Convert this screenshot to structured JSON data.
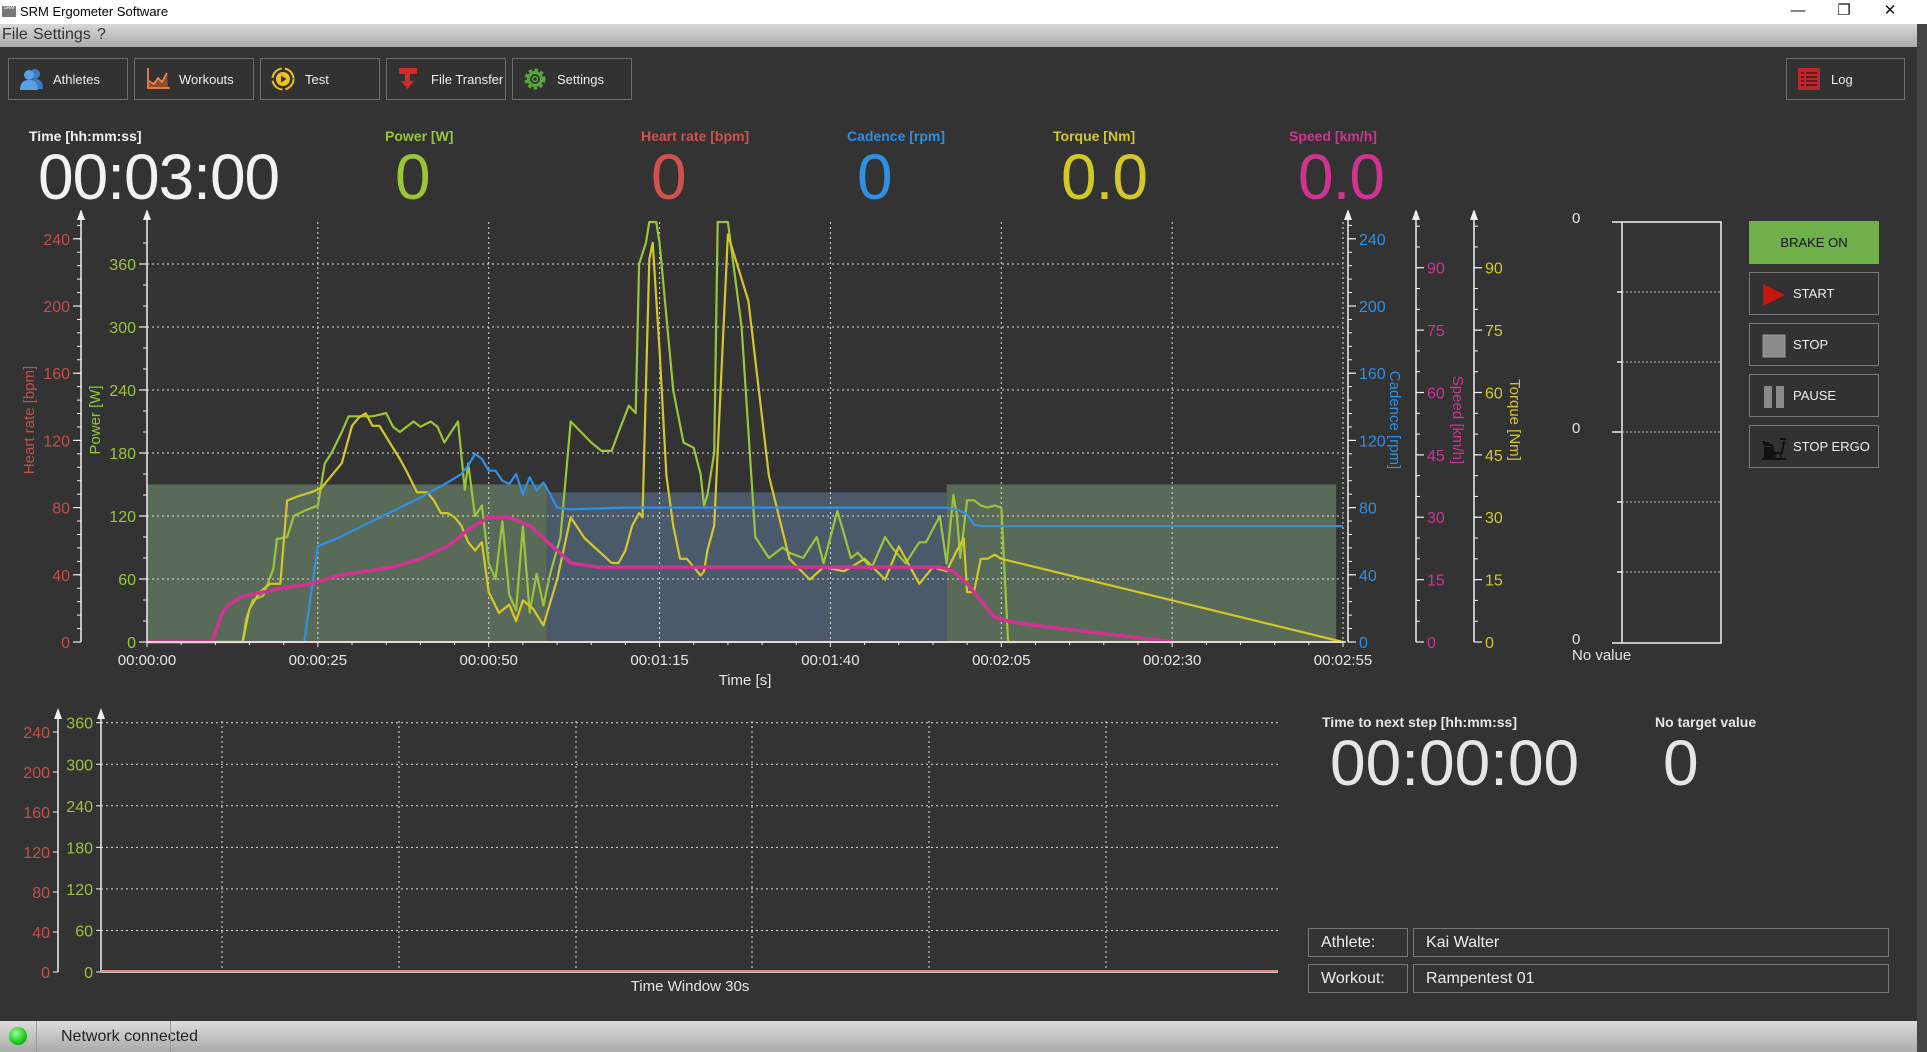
{
  "window": {
    "title": "SRM Ergometer Software",
    "minimize_glyph": "—",
    "restore_glyph": "❐",
    "close_glyph": "✕"
  },
  "menu": [
    "File",
    "Settings",
    "?"
  ],
  "toolbar": {
    "buttons": [
      {
        "label": "Athletes",
        "icon": "athletes-icon",
        "color": "#4a90d9"
      },
      {
        "label": "Workouts",
        "icon": "workouts-chart-icon",
        "color": "#e0783a"
      },
      {
        "label": "Test",
        "icon": "test-play-icon",
        "color": "#f0c020"
      },
      {
        "label": "File Transfer",
        "icon": "file-transfer-icon",
        "color": "#d22a2a"
      },
      {
        "label": "Settings",
        "icon": "settings-gear-icon",
        "color": "#5aa83c"
      }
    ],
    "log": {
      "label": "Log",
      "icon": "log-list-icon",
      "color": "#b8292f"
    }
  },
  "metrics": [
    {
      "label": "Time [hh:mm:ss]",
      "value": "00:03:00",
      "color": "#f2f2f2"
    },
    {
      "label": "Power [W]",
      "value": "0",
      "color": "#9cc43a"
    },
    {
      "label": "Heart rate [bpm]",
      "value": "0",
      "color": "#d0524f"
    },
    {
      "label": "Cadence [rpm]",
      "value": "0",
      "color": "#2f8fe3"
    },
    {
      "label": "Torque [Nm]",
      "value": "0.0",
      "color": "#d2c82a"
    },
    {
      "label": "Speed [km/h]",
      "value": "0.0",
      "color": "#cf3590"
    }
  ],
  "chart_data": [
    {
      "type": "line",
      "name": "main-chart",
      "xlabel": "Time [s]",
      "xlim": [
        0,
        175
      ],
      "x_ticks": [
        {
          "t": 0,
          "label": "00:00:00"
        },
        {
          "t": 25,
          "label": "00:00:25"
        },
        {
          "t": 50,
          "label": "00:00:50"
        },
        {
          "t": 75,
          "label": "00:01:15"
        },
        {
          "t": 100,
          "label": "00:01:40"
        },
        {
          "t": 125,
          "label": "00:02:05"
        },
        {
          "t": 150,
          "label": "00:02:30"
        },
        {
          "t": 175,
          "label": "00:02:55"
        }
      ],
      "grid": true,
      "axes": [
        {
          "key": "hr",
          "label": "Heart rate [bpm]",
          "color": "#c0504d",
          "side": "left",
          "range": [
            0,
            250
          ],
          "ticks": [
            0,
            40,
            80,
            120,
            160,
            200,
            240
          ]
        },
        {
          "key": "power",
          "label": "Power [W]",
          "color": "#9cc43a",
          "side": "left",
          "range": [
            0,
            400
          ],
          "ticks": [
            0,
            60,
            120,
            180,
            240,
            300,
            360
          ]
        },
        {
          "key": "cadence",
          "label": "Cadence [rpm]",
          "color": "#2f8fe3",
          "side": "right",
          "range": [
            0,
            250
          ],
          "ticks": [
            0,
            40,
            80,
            120,
            160,
            200,
            240
          ]
        },
        {
          "key": "speed",
          "label": "Speed [km/h]",
          "color": "#cf3590",
          "side": "right",
          "range": [
            0,
            101
          ],
          "ticks": [
            0,
            15,
            30,
            45,
            60,
            75,
            90
          ]
        },
        {
          "key": "torque",
          "label": "Torque [Nm]",
          "color": "#d2c82a",
          "side": "right",
          "range": [
            0,
            101
          ],
          "ticks": [
            0,
            15,
            30,
            45,
            60,
            75,
            90
          ]
        }
      ],
      "zones": [
        {
          "t0": 0,
          "t1": 58.5,
          "axis": "power",
          "level": 150,
          "color": "#5a6a58"
        },
        {
          "t0": 58.5,
          "t1": 117,
          "axis": "cadence",
          "level": 89,
          "color": "#4a5a6a"
        },
        {
          "t0": 117,
          "t1": 174,
          "axis": "power",
          "level": 150,
          "color": "#5a6a58"
        }
      ],
      "series": [
        {
          "name": "Power",
          "axis": "power",
          "color": "#9cc43a",
          "t": [
            0,
            14,
            14.5,
            15.5,
            17,
            18.5,
            19,
            20.5,
            21.5,
            23,
            25,
            26,
            27,
            28.5,
            29.5,
            31,
            33,
            35,
            36,
            37,
            38,
            39,
            40,
            41.5,
            42.5,
            43.5,
            44.5,
            45.5,
            46.5,
            47,
            48,
            48.5,
            49,
            50,
            51,
            52,
            53,
            54,
            55,
            56,
            57,
            58,
            59,
            60.5,
            62,
            63.5,
            65,
            66.5,
            68,
            69,
            70.5,
            71.5,
            72,
            73,
            73.5,
            74.5,
            75,
            77,
            78.5,
            80,
            81,
            81.5,
            82,
            83,
            83.5,
            85,
            87,
            89,
            91,
            93,
            94,
            96,
            98,
            99,
            101,
            103,
            104,
            106,
            108,
            109,
            111,
            113,
            114,
            116,
            117,
            118,
            118.5,
            119,
            120,
            121,
            122,
            123,
            124,
            125,
            126,
            127,
            128,
            175
          ],
          "v": [
            0,
            0,
            22,
            40,
            44,
            70,
            98,
            100,
            120,
            125,
            130,
            170,
            180,
            200,
            215,
            215,
            215,
            218,
            205,
            200,
            205,
            210,
            205,
            210,
            205,
            190,
            200,
            210,
            145,
            170,
            120,
            125,
            130,
            75,
            60,
            115,
            45,
            30,
            110,
            28,
            65,
            35,
            65,
            100,
            210,
            200,
            190,
            182,
            182,
            200,
            225,
            218,
            360,
            380,
            420,
            450,
            380,
            240,
            190,
            185,
            160,
            130,
            140,
            180,
            400,
            400,
            300,
            100,
            80,
            90,
            85,
            80,
            100,
            75,
            125,
            80,
            85,
            70,
            100,
            90,
            75,
            95,
            95,
            120,
            75,
            140,
            120,
            80,
            135,
            135,
            130,
            128,
            130,
            128,
            0,
            0
          ]
        },
        {
          "name": "Torque",
          "axis": "torque",
          "color": "#d2c82a",
          "t": [
            0,
            14,
            15,
            16.5,
            18,
            19.5,
            20.5,
            22,
            24,
            25.5,
            27,
            28.5,
            30,
            31,
            32,
            33,
            34,
            35.5,
            37,
            38,
            39.5,
            41,
            42,
            43,
            44,
            45,
            46,
            47,
            48,
            49,
            50,
            51.5,
            53,
            54,
            55,
            56.5,
            58,
            60,
            62,
            64,
            66,
            68,
            69,
            70,
            71,
            72,
            72.5,
            73.5,
            74,
            75,
            76,
            77,
            78,
            79,
            80,
            81,
            81.5,
            82,
            83,
            85,
            88,
            91,
            94,
            97,
            99,
            102,
            105,
            108,
            110,
            113,
            115,
            117,
            118.5,
            119.5,
            120,
            121,
            122,
            123,
            124,
            125,
            175
          ],
          "v": [
            0,
            0,
            8,
            12,
            14,
            14,
            34,
            35,
            36,
            37,
            40,
            43,
            52,
            54,
            55,
            52,
            52,
            48,
            44,
            41,
            36,
            36,
            34,
            31,
            31,
            30,
            28,
            24,
            22,
            24,
            12,
            7,
            9,
            5,
            10,
            8,
            4,
            15,
            30,
            25,
            22,
            19,
            19,
            22,
            28,
            31,
            30,
            92,
            96,
            70,
            40,
            28,
            20,
            20,
            18,
            16,
            17,
            22,
            28,
            98,
            82,
            40,
            20,
            15,
            18,
            17,
            20,
            15,
            23,
            14,
            18,
            17,
            22,
            25,
            12,
            12,
            20,
            20,
            21,
            20,
            0,
            0
          ]
        },
        {
          "name": "Cadence",
          "axis": "cadence",
          "color": "#2f8fe3",
          "t": [
            0,
            11.5,
            12.5,
            14,
            15,
            16,
            18,
            19,
            21,
            23,
            25,
            28,
            32,
            36,
            40,
            44,
            46,
            47,
            48,
            49,
            50,
            51,
            52,
            53,
            54,
            55,
            56,
            57,
            58,
            59,
            60,
            62,
            70,
            80,
            90,
            100,
            110,
            115,
            117,
            119,
            120,
            121,
            122,
            124,
            175
          ],
          "v": [
            0,
            0,
            0,
            0,
            0,
            0,
            0,
            0,
            0,
            0,
            57,
            62,
            70,
            78,
            86,
            95,
            100,
            105,
            112,
            109,
            102,
            102,
            96,
            94,
            100,
            88,
            98,
            90,
            95,
            88,
            80,
            79,
            80,
            80,
            80,
            80,
            80,
            80,
            80,
            78,
            76,
            70,
            69,
            69,
            69
          ]
        },
        {
          "name": "Speed",
          "axis": "speed",
          "color": "#cf3590",
          "t": [
            0,
            9.5,
            11,
            12,
            14,
            17,
            20,
            24,
            28,
            32,
            36,
            40,
            44,
            47,
            50,
            53,
            56,
            58,
            60,
            62,
            66,
            70,
            75,
            80,
            90,
            100,
            110,
            116,
            118,
            120,
            122,
            124,
            126,
            130,
            135,
            140,
            145,
            150
          ],
          "v": [
            0,
            0,
            7,
            9,
            11,
            12,
            13,
            14,
            16,
            17,
            18,
            20,
            23,
            27,
            30,
            30,
            28,
            25,
            22,
            19,
            18,
            18,
            18,
            18,
            18,
            18,
            18,
            18,
            17,
            14,
            10,
            6,
            5,
            4,
            3,
            2,
            1,
            0
          ]
        },
        {
          "name": "Heart rate",
          "axis": "hr",
          "color": "#e08080",
          "t": [
            0,
            175
          ],
          "v": [
            0,
            0
          ]
        }
      ]
    },
    {
      "type": "line",
      "name": "time-window-chart",
      "xlabel": "Time Window 30s",
      "grid": true,
      "axes": [
        {
          "key": "hr",
          "color": "#c0504d",
          "range": [
            0,
            250
          ],
          "ticks": [
            0,
            40,
            80,
            120,
            160,
            200,
            240
          ]
        },
        {
          "key": "power",
          "color": "#9cc43a",
          "range": [
            0,
            400
          ],
          "ticks": [
            0,
            60,
            120,
            180,
            240,
            300,
            360
          ]
        }
      ],
      "series": [
        {
          "name": "Heart rate",
          "t": [
            0,
            30
          ],
          "v": [
            0,
            0
          ],
          "color": "#e08a8a"
        }
      ]
    }
  ],
  "gauge": {
    "top_label": "0",
    "mid_label": "0",
    "bottom_label": "0",
    "caption": "No value"
  },
  "controls": [
    {
      "label": "BRAKE ON",
      "icon": "",
      "active": true,
      "color": "#6fb04a"
    },
    {
      "label": "START",
      "icon": "play-icon"
    },
    {
      "label": "STOP",
      "icon": "stop-icon"
    },
    {
      "label": "PAUSE",
      "icon": "pause-icon"
    },
    {
      "label": "STOP ERGO",
      "icon": "ergometer-bike-icon"
    }
  ],
  "next_step": {
    "label": "Time to next step [hh:mm:ss]",
    "value": "00:00:00"
  },
  "target": {
    "label": "No target value",
    "value": "0"
  },
  "athlete": {
    "label": "Athlete:",
    "value": "Kai Walter"
  },
  "workout": {
    "label": "Workout:",
    "value": "Rampentest 01"
  },
  "status": {
    "text": "Network connected",
    "indicator_color": "#22cc22"
  }
}
